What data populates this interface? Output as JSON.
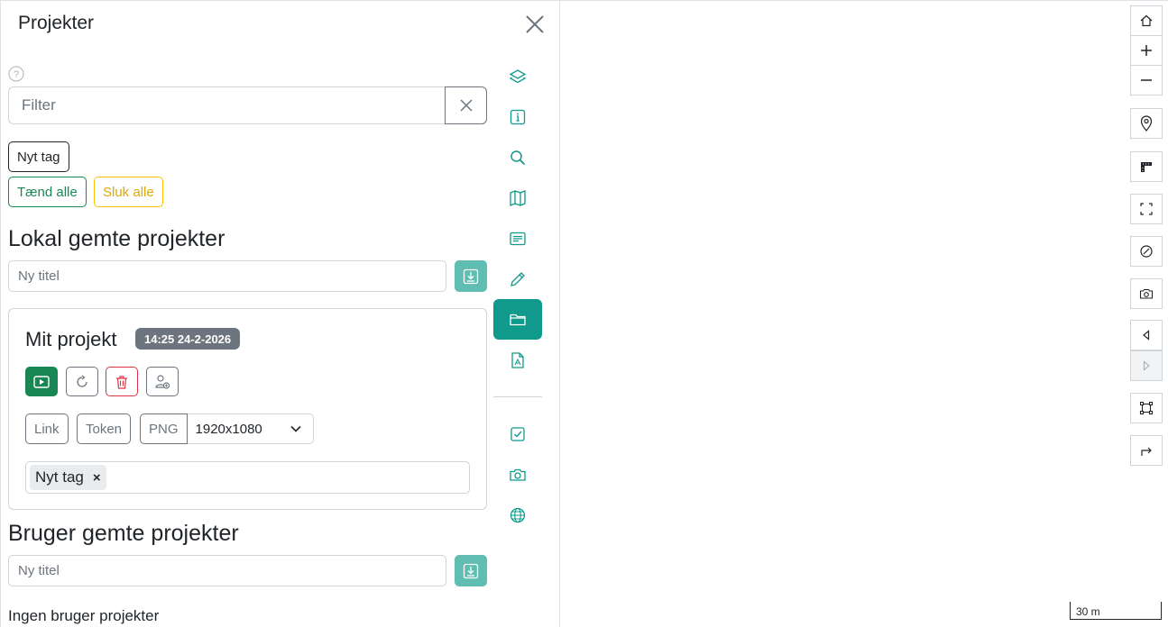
{
  "panel": {
    "title": "Projekter"
  },
  "filter": {
    "placeholder": "Filter"
  },
  "buttons": {
    "new_tag": "Nyt tag",
    "turn_on_all": "Tænd alle",
    "turn_off_all": "Sluk alle"
  },
  "local": {
    "title": "Lokal gemte projekter",
    "title_placeholder": "Ny titel",
    "project": {
      "name": "Mit projekt",
      "date": "14:25 24-2-2026",
      "link_label": "Link",
      "token_label": "Token",
      "png_label": "PNG",
      "resolution": "1920x1080",
      "tags": [
        "Nyt tag"
      ]
    }
  },
  "user": {
    "title": "Bruger gemte projekter",
    "title_placeholder": "Ny titel",
    "empty": "Ingen bruger projekter"
  },
  "rail": {
    "items": [
      "layers-icon",
      "info-icon",
      "search-icon",
      "map-icon",
      "legend-icon",
      "draw-icon",
      "projects-icon",
      "print-pdf-icon",
      "checkbox-icon",
      "camera-icon",
      "globe-icon"
    ],
    "active": "projects-icon",
    "accent": "#0f9a8b"
  },
  "map": {
    "scale": "30 m",
    "controls": [
      "home-icon",
      "zoom-in-icon",
      "zoom-out-icon",
      "location-icon",
      "measure-icon",
      "fullscreen-icon",
      "clear-icon",
      "screenshot-icon",
      "back-icon",
      "forward-icon",
      "extent-icon",
      "redirect-icon"
    ]
  },
  "colors": {
    "teal": "#0f9a8b",
    "save": "#5fbdb1",
    "success": "#198754",
    "warning": "#ffc107",
    "danger": "#dc3545",
    "secondary": "#6c757d"
  }
}
